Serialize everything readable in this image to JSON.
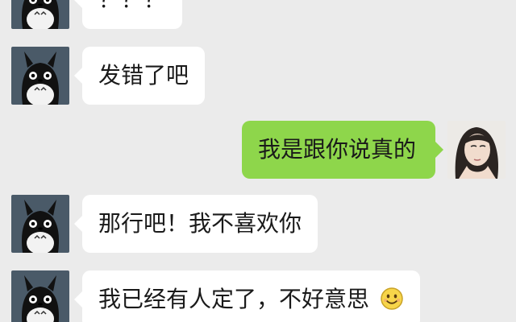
{
  "chat": {
    "messages": [
      {
        "sender": "contact",
        "text": "？？？"
      },
      {
        "sender": "contact",
        "text": "发错了吧"
      },
      {
        "sender": "me",
        "text": "我是跟你说真的"
      },
      {
        "sender": "contact",
        "text": "那行吧！我不喜欢你"
      },
      {
        "sender": "contact",
        "text": "我已经有人定了，不好意思",
        "emoji": "smile-emoji-icon"
      }
    ]
  },
  "colors": {
    "background": "#ebebeb",
    "incoming_bubble": "#ffffff",
    "outgoing_bubble": "#8ed64b"
  }
}
